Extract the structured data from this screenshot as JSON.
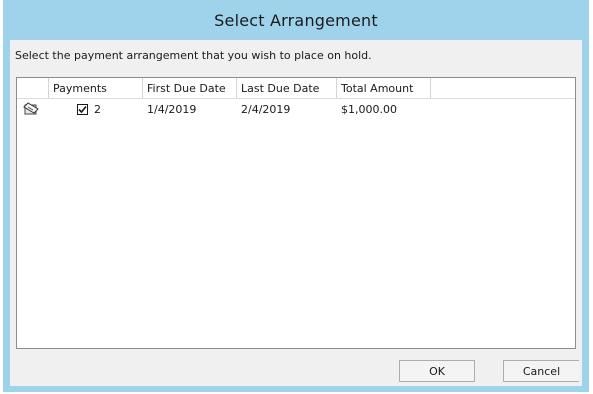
{
  "dialog": {
    "title": "Select Arrangement",
    "instruction": "Select the payment arrangement that you wish to place on hold."
  },
  "grid": {
    "columns": [
      "",
      "Payments",
      "First Due Date",
      "Last Due Date",
      "Total Amount"
    ],
    "rows": [
      {
        "icon": "row-note-icon",
        "checked": true,
        "payments": "2",
        "first_due_date": "1/4/2019",
        "last_due_date": "2/4/2019",
        "total_amount": "$1,000.00"
      }
    ]
  },
  "buttons": {
    "ok": "OK",
    "cancel": "Cancel"
  },
  "colors": {
    "frame": "#9fd3ec",
    "client": "#f0f0f0",
    "grid_bg": "#ffffff"
  }
}
